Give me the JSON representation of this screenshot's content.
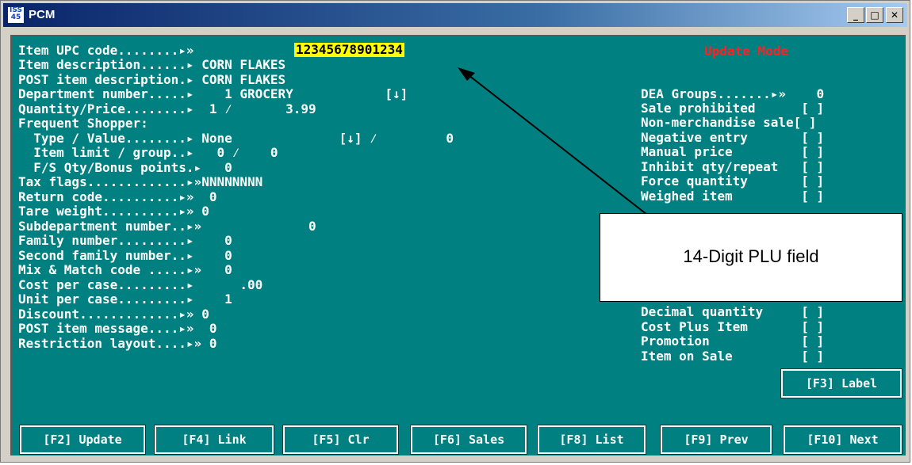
{
  "window": {
    "title": "PCM",
    "app_icon_text": "ISS 45",
    "min": "_",
    "max": "□",
    "close": "✕"
  },
  "mode": "Update Mode",
  "upc": {
    "label": "Item UPC code........▸»",
    "value": "12345678901234"
  },
  "left_lines": [
    "Item description......▸ CORN FLAKES",
    "POST item description.▸ CORN FLAKES",
    "Department number.....▸    1 GROCERY            [↓]",
    "Quantity/Price........▸  1 ⁄       3.99",
    "Frequent Shopper:",
    "  Type / Value........▸ None              [↓] ⁄         0",
    "  Item limit / group..▸   0 ⁄    0",
    "  F/S Qty/Bonus points.▸   0",
    "Tax flags.............▸»NNNNNNNN",
    "Return code..........▸»  0",
    "Tare weight..........▸» 0",
    "Subdepartment number..▸»              0",
    "Family number.........▸    0",
    "Second family number..▸    0",
    "Mix & Match code .....▸»   0",
    "Cost per case.........▸      .00",
    "Unit per case.........▸    1",
    "Discount.............▸» 0",
    "POST item message....▸»  0",
    "Restriction layout....▸» 0"
  ],
  "right_lines": [
    "DEA Groups.......▸»    0",
    "Sale prohibited      [ ]",
    "Non-merchandise sale[ ]",
    "Negative entry       [ ]",
    "Manual price         [ ]",
    "Inhibit qty/repeat   [ ]",
    "Force quantity       [ ]",
    "Weighed item         [ ]",
    "Decimal quantity     [ ]",
    "Cost Plus Item       [ ]",
    "Promotion            [ ]",
    "Item on Sale         [ ]"
  ],
  "label_button": "[F3] Label",
  "fkeys": [
    "[F2] Update",
    "[F4] Link",
    "[F5] Clr",
    "[F6] Sales",
    "[F8] List",
    "[F9] Prev",
    "[F10] Next"
  ],
  "callout": "14-Digit PLU field"
}
